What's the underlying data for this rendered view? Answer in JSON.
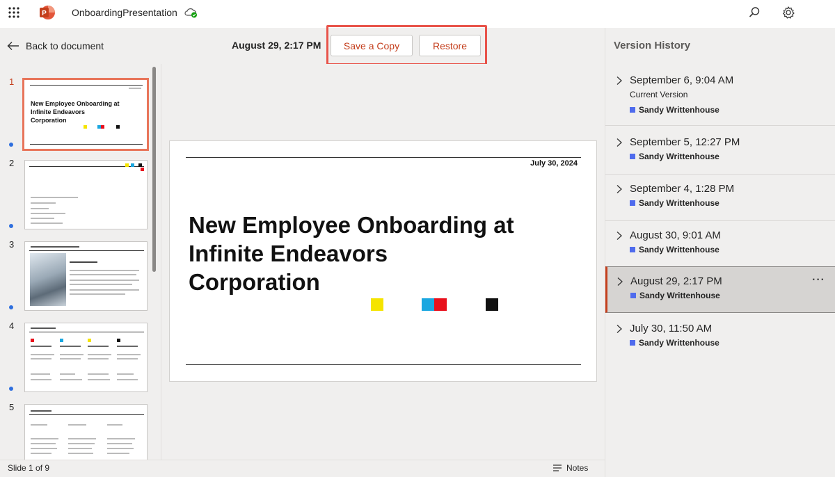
{
  "app": {
    "document_title": "OnboardingPresentation"
  },
  "command_bar": {
    "back_label": "Back to document",
    "version_date": "August 29, 2:17 PM",
    "save_copy_label": "Save a Copy",
    "restore_label": "Restore"
  },
  "thumbnails": [
    {
      "number": "1",
      "active": true
    },
    {
      "number": "2",
      "active": false
    },
    {
      "number": "3",
      "active": false
    },
    {
      "number": "4",
      "active": false
    },
    {
      "number": "5",
      "active": false
    }
  ],
  "thumb1": {
    "title": "New Employee Onboarding at Infinite Endeavors Corporation"
  },
  "slide": {
    "date": "July 30, 2024",
    "title": "New Employee Onboarding at Infinite Endeavors Corporation",
    "square_colors": [
      "#f5e400",
      "#1aa7e0",
      "#e8101c",
      "#111111"
    ]
  },
  "status": {
    "slide_count": "Slide 1 of 9",
    "notes_label": "Notes"
  },
  "version_history": {
    "title": "Version History",
    "items": [
      {
        "date": "September 6, 9:04 AM",
        "sub": "Current Version",
        "author": "Sandy Writtenhouse"
      },
      {
        "date": "September 5, 12:27 PM",
        "sub": "",
        "author": "Sandy Writtenhouse"
      },
      {
        "date": "September 4, 1:28 PM",
        "sub": "",
        "author": "Sandy Writtenhouse"
      },
      {
        "date": "August 30, 9:01 AM",
        "sub": "",
        "author": "Sandy Writtenhouse"
      },
      {
        "date": "August 29, 2:17 PM",
        "sub": "",
        "author": "Sandy Writtenhouse",
        "selected": true,
        "more": "···"
      },
      {
        "date": "July 30, 11:50 AM",
        "sub": "",
        "author": "Sandy Writtenhouse"
      }
    ]
  },
  "colors": {
    "accent": "#c43e1c",
    "highlight": "#e8534a",
    "author_swatch": "#4f6bed"
  }
}
